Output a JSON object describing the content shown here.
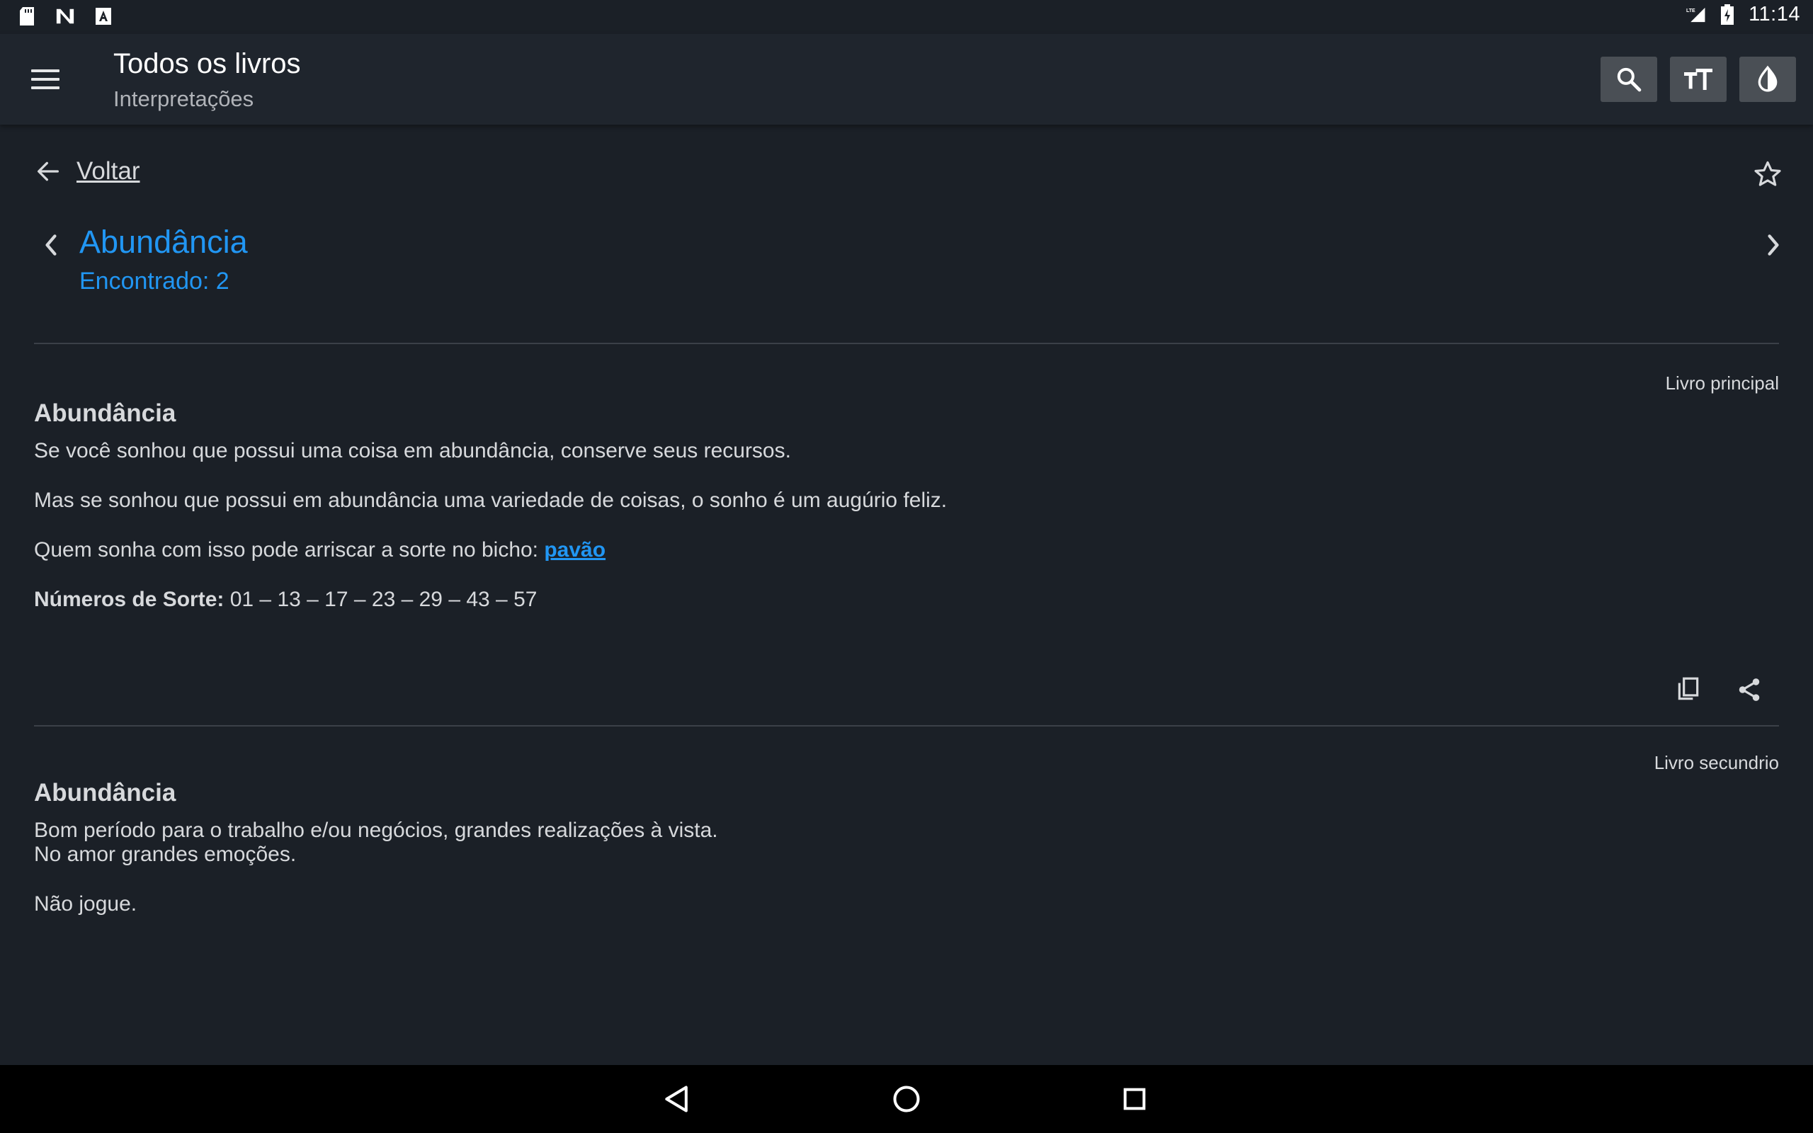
{
  "status_bar": {
    "left_icons": [
      "sd-card-icon",
      "n-notification-icon",
      "a-notification-icon"
    ],
    "network": "LTE",
    "time": "11:14"
  },
  "app_bar": {
    "title": "Todos os livros",
    "subtitle": "Interpretações",
    "actions": [
      "search-icon",
      "text-size-icon",
      "contrast-icon"
    ]
  },
  "nav": {
    "back_label": "Voltar"
  },
  "entry": {
    "title": "Abundância",
    "found": "Encontrado: 2"
  },
  "cards": [
    {
      "book": "Livro principal",
      "title": "Abundância",
      "p1": "Se você sonhou que possui uma coisa em abundância, conserve seus recursos.",
      "p2": "Mas se sonhou que possui em abundância uma variedade de coisas, o sonho é um augúrio feliz.",
      "p3_text": "Quem sonha com isso pode arriscar a sorte no bicho: ",
      "p3_link": "pavão",
      "lucky_label": "Números de Sorte:",
      "lucky_numbers": " 01 – 13 – 17 – 23 – 29 – 43 – 57"
    },
    {
      "book": "Livro secundrio",
      "title": "Abundância",
      "p1": "Bom período para o trabalho e/ou negócios, grandes realizações à vista.",
      "p2": "No amor grandes emoções.",
      "p3": "Não jogue."
    }
  ],
  "colors": {
    "background": "#1b2027",
    "app_bar": "#1f252d",
    "accent": "#2196f3",
    "text": "#d7d9dc"
  }
}
